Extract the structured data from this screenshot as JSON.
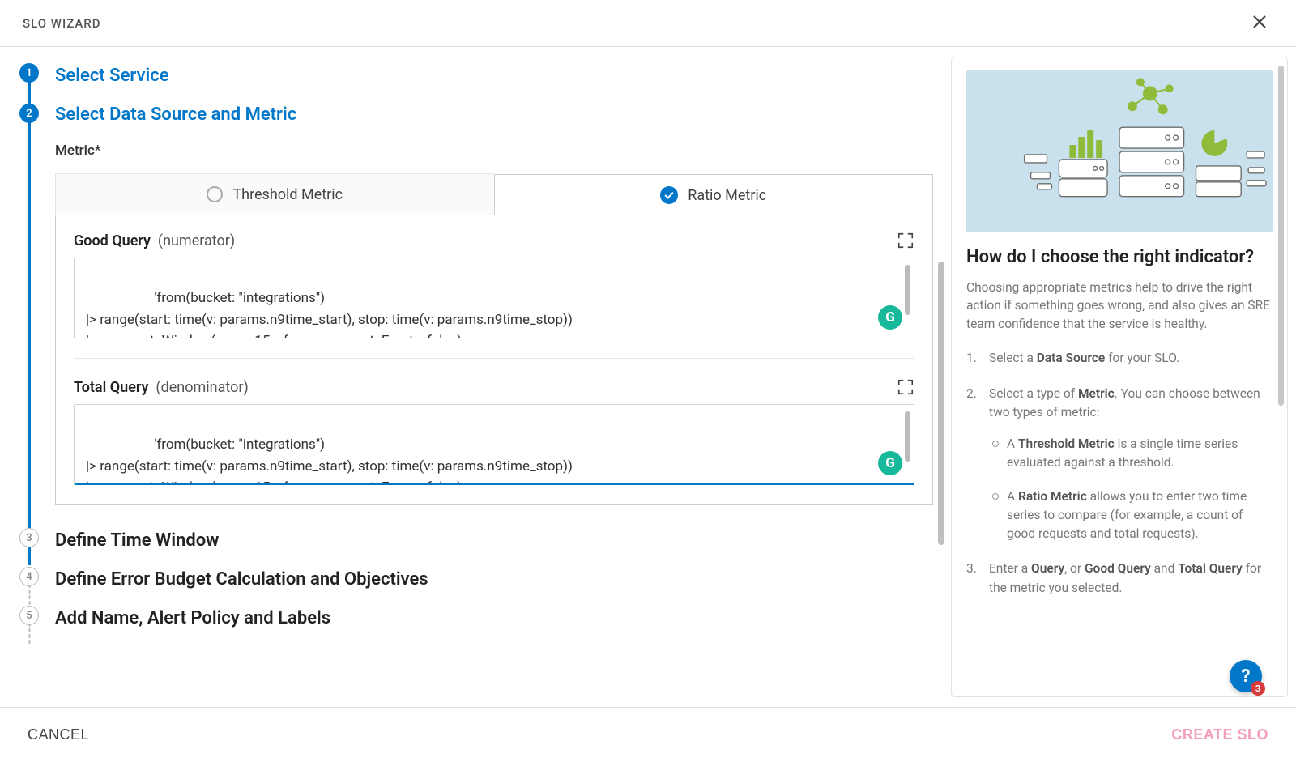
{
  "header": {
    "title": "SLO WIZARD"
  },
  "steps": {
    "s1": "Select Service",
    "s2": "Select Data Source and Metric",
    "s3": "Define Time Window",
    "s4": "Define Error Budget Calculation and Objectives",
    "s5": "Add Name, Alert Policy and Labels"
  },
  "metric": {
    "label": "Metric*",
    "tabs": {
      "threshold": "Threshold Metric",
      "ratio": "Ratio Metric"
    },
    "good_query": {
      "title_bold": "Good Query",
      "title_paren": "(numerator)",
      "text": "'from(bucket: \"integrations\")\n|> range(start: time(v: params.n9time_start), stop: time(v: params.n9time_stop))\n|> aggregateWindow(every: 15s, fn: mean, createEmpty: false)\n|> filter(fn: (r) => r[\"_measurement\"] == \"internal_write\")"
    },
    "total_query": {
      "title_bold": "Total Query",
      "title_paren": "(denominator)",
      "text": "'from(bucket: \"integrations\")\n|> range(start: time(v: params.n9time_start), stop: time(v: params.n9time_stop))\n|> aggregateWindow(every: 15s, fn: mean, createEmpty: false)\n|> filter(fn: (r) => r[\"_measurement\"] == \"internal_write\")"
    }
  },
  "help": {
    "heading": "How do I choose the right indicator?",
    "intro": "Choosing appropriate metrics help to drive the right action if something goes wrong, and also gives an SRE team confidence that the service is healthy.",
    "li1_a": "Select a ",
    "li1_b": "Data Source",
    "li1_c": " for your SLO.",
    "li2_a": "Select a type of ",
    "li2_b": "Metric",
    "li2_c": ". You can choose between two types of metric:",
    "sub1_a": "A ",
    "sub1_b": "Threshold Metric",
    "sub1_c": " is a single time series evaluated against a threshold.",
    "sub2_a": "A ",
    "sub2_b": "Ratio Metric",
    "sub2_c": " allows you to enter two time series to compare (for example, a count of good requests and total requests).",
    "li3_a": "Enter a ",
    "li3_b": "Query",
    "li3_c": ", or ",
    "li3_d": "Good Query",
    "li3_e": " and ",
    "li3_f": "Total Query",
    "li3_g": " for the metric you selected."
  },
  "footer": {
    "cancel": "CANCEL",
    "create": "CREATE SLO"
  },
  "fab": {
    "badge": "3"
  }
}
